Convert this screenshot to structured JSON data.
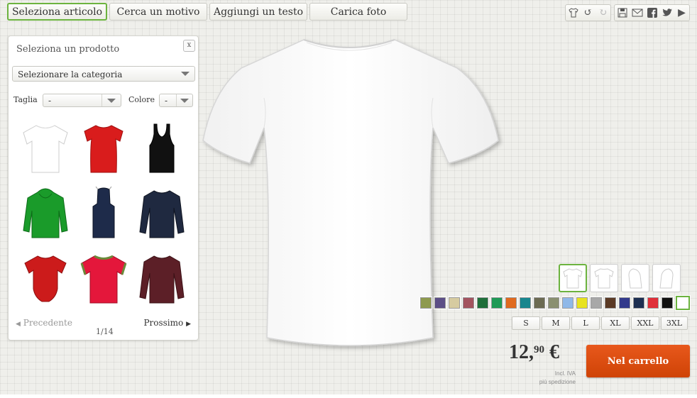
{
  "tabs": [
    {
      "label": "Seleziona articolo"
    },
    {
      "label": "Cerca un motivo"
    },
    {
      "label": "Aggiungi un testo"
    },
    {
      "label": "Carica foto"
    }
  ],
  "toolbar": {
    "icons": [
      "tshirt-edit-icon",
      "undo-icon",
      "redo-icon",
      "save-icon",
      "email-icon",
      "facebook-icon",
      "twitter-icon",
      "play-icon"
    ]
  },
  "panel": {
    "title": "Seleziona un prodotto",
    "close_glyph": "x",
    "category_select": "Selezionare la categoria",
    "size_label": "Taglia",
    "size_value": "-",
    "color_label": "Colore",
    "color_value": "-",
    "products": [
      {
        "name": "t-shirt",
        "color": "#ffffff"
      },
      {
        "name": "women-t-shirt",
        "color": "#d91c1c"
      },
      {
        "name": "tank-top",
        "color": "#111111"
      },
      {
        "name": "hoodie",
        "color": "#1a9b2a"
      },
      {
        "name": "apron",
        "color": "#1e2b4a"
      },
      {
        "name": "long-sleeve",
        "color": "#1f2940"
      },
      {
        "name": "baby-bodysuit",
        "color": "#cc1b1b"
      },
      {
        "name": "ringer-t-shirt",
        "color": "#e4173b"
      },
      {
        "name": "sweatshirt",
        "color": "#5c1f27"
      }
    ],
    "prev": "Precedente",
    "next": "Prossimo",
    "page": "1/14"
  },
  "views": [
    "front",
    "back",
    "left",
    "right"
  ],
  "colors": [
    "#8e9a4e",
    "#5b4e86",
    "#d6cba0",
    "#a3535f",
    "#1f6f3a",
    "#1f9a56",
    "#e06a1f",
    "#18868e",
    "#6b6a52",
    "#8a9070",
    "#8fb8e8",
    "#e8e31e",
    "#a8a8a8",
    "#5b3a25",
    "#333a8c",
    "#1d2f52",
    "#e0303a",
    "#111111",
    "#ffffff"
  ],
  "sizes": [
    "S",
    "M",
    "L",
    "XL",
    "XXL",
    "3XL"
  ],
  "price": {
    "main": "12,",
    "cents": "90",
    "currency": "€"
  },
  "price_notes": [
    "Incl. IVA",
    "più spedizione"
  ],
  "cart_button": "Nel carrello"
}
